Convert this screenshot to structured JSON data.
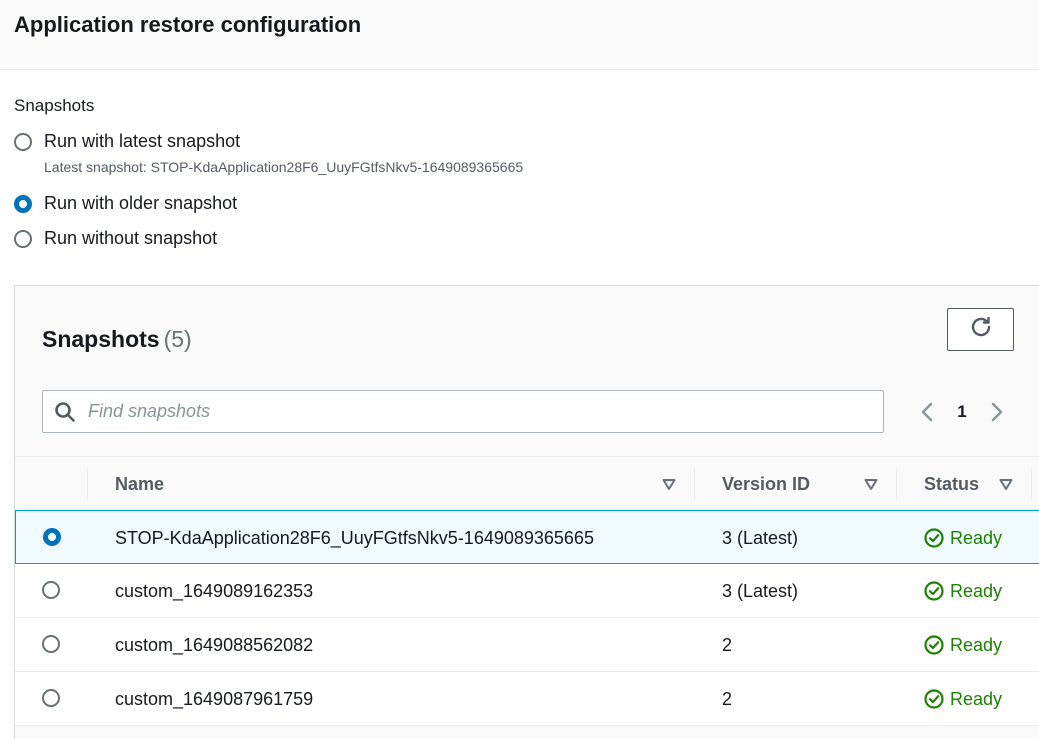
{
  "header": {
    "title": "Application restore configuration"
  },
  "snapshots_option": {
    "label": "Snapshots",
    "options": [
      {
        "label": "Run with latest snapshot",
        "checked": false,
        "description": "Latest snapshot: STOP-KdaApplication28F6_UuyFGtfsNkv5-1649089365665"
      },
      {
        "label": "Run with older snapshot",
        "checked": true
      },
      {
        "label": "Run without snapshot",
        "checked": false
      }
    ]
  },
  "table_panel": {
    "title": "Snapshots",
    "count": "(5)",
    "refresh_icon": "refresh-icon",
    "search": {
      "placeholder": "Find snapshots",
      "value": ""
    },
    "pagination": {
      "current_page": "1"
    },
    "columns": [
      "Name",
      "Version ID",
      "Status"
    ],
    "rows": [
      {
        "name": "STOP-KdaApplication28F6_UuyFGtfsNkv5-1649089365665",
        "version": "3 (Latest)",
        "status": "Ready",
        "selected": true
      },
      {
        "name": "custom_1649089162353",
        "version": "3 (Latest)",
        "status": "Ready",
        "selected": false
      },
      {
        "name": "custom_1649088562082",
        "version": "2",
        "status": "Ready",
        "selected": false
      },
      {
        "name": "custom_1649087961759",
        "version": "2",
        "status": "Ready",
        "selected": false
      }
    ]
  },
  "colors": {
    "accent": "#0073bb",
    "success": "#1d8102",
    "selected_row_bg": "#f1faff",
    "selected_row_border": "#00a1c9"
  }
}
